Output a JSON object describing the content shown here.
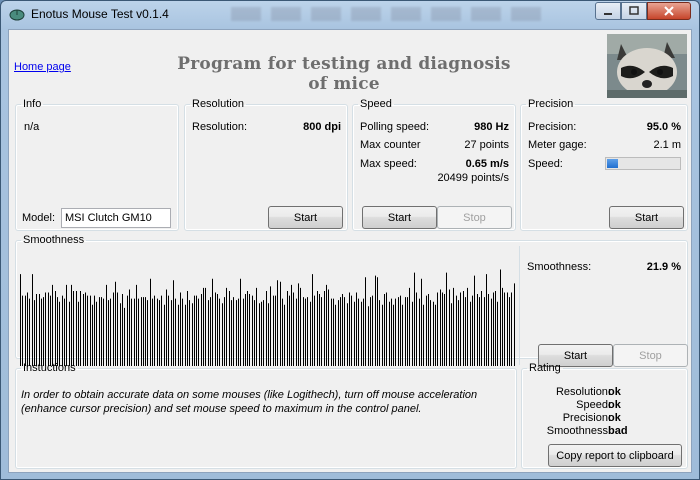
{
  "window": {
    "title": "Enotus Mouse Test v0.1.4"
  },
  "header": {
    "home_link": "Home page",
    "headline": "Program for testing and diagnosis of mice"
  },
  "info": {
    "legend": "Info",
    "status": "n/a",
    "model_label": "Model:",
    "model_value": "MSI Clutch GM10"
  },
  "resolution": {
    "legend": "Resolution",
    "label": "Resolution:",
    "value": "800 dpi",
    "start_label": "Start"
  },
  "speed": {
    "legend": "Speed",
    "polling_label": "Polling speed:",
    "polling_value": "980 Hz",
    "max_counter_label": "Max counter",
    "max_counter_value": "27 points",
    "max_speed_label": "Max  speed:",
    "max_speed_value": "0.65 m/s",
    "max_speed_points": "20499 points/s",
    "start_label": "Start",
    "stop_label": "Stop"
  },
  "precision": {
    "legend": "Precision",
    "precision_label": "Precision:",
    "precision_value": "95.0 %",
    "meter_gage_label": "Meter gage:",
    "meter_gage_value": "2.1 m",
    "speed_label": "Speed:",
    "speed_fraction": 0.15,
    "start_label": "Start"
  },
  "smoothness": {
    "legend": "Smoothness",
    "label": "Smoothness:",
    "value": "21.9 %",
    "start_label": "Start",
    "stop_label": "Stop",
    "bars": [
      60,
      46,
      46,
      48,
      44,
      60,
      43,
      47,
      47,
      44,
      45,
      48,
      48,
      46,
      53,
      49,
      45,
      42,
      46,
      44,
      53,
      42,
      53,
      49,
      49,
      42,
      49,
      47,
      48,
      46,
      46,
      40,
      46,
      42,
      45,
      45,
      44,
      53,
      43,
      44,
      48,
      55,
      48,
      41,
      47,
      38,
      46,
      50,
      44,
      44,
      53,
      44,
      45,
      45,
      45,
      43,
      57,
      44,
      46,
      44,
      43,
      46,
      40,
      50,
      46,
      43,
      56,
      44,
      40,
      48,
      44,
      40,
      49,
      43,
      41,
      46,
      46,
      44,
      47,
      51,
      51,
      43,
      45,
      57,
      48,
      47,
      44,
      41,
      45,
      51,
      49,
      43,
      45,
      43,
      44,
      57,
      44,
      47,
      49,
      47,
      46,
      43,
      51,
      41,
      42,
      43,
      49,
      41,
      52,
      46,
      46,
      56,
      55,
      44,
      40,
      49,
      46,
      53,
      48,
      44,
      54,
      51,
      45,
      44,
      45,
      42,
      60,
      46,
      49,
      47,
      45,
      49,
      53,
      50,
      44,
      44,
      40,
      43,
      45,
      47,
      45,
      41,
      48,
      46,
      42,
      48,
      44,
      42,
      44,
      58,
      39,
      45,
      46,
      59,
      58,
      43,
      40,
      47,
      48,
      42,
      44,
      40,
      44,
      45,
      46,
      40,
      45,
      45,
      51,
      42,
      61,
      48,
      44,
      57,
      40,
      46,
      47,
      43,
      42,
      40,
      48,
      50,
      48,
      47,
      61,
      50,
      41,
      51,
      46,
      43,
      48,
      49,
      45,
      51,
      42,
      46,
      59,
      47,
      45,
      49,
      45,
      60,
      47,
      44,
      48,
      49,
      42,
      63,
      51,
      48,
      48,
      45,
      48,
      54
    ]
  },
  "instructions": {
    "legend": "Instuctions",
    "text": "In order to obtain accurate data on some mouses (like Logithech), turn off mouse acceleration (enhance cursor precision) and set mouse speed to maximum in the control panel."
  },
  "rating": {
    "legend": "Rating",
    "items": [
      {
        "label": "Resolution:",
        "value": "ok"
      },
      {
        "label": "Speed:",
        "value": "ok"
      },
      {
        "label": "Precision:",
        "value": "ok"
      },
      {
        "label": "Smoothness:",
        "value": "bad"
      }
    ],
    "copy_label": "Copy report to clipboard"
  }
}
